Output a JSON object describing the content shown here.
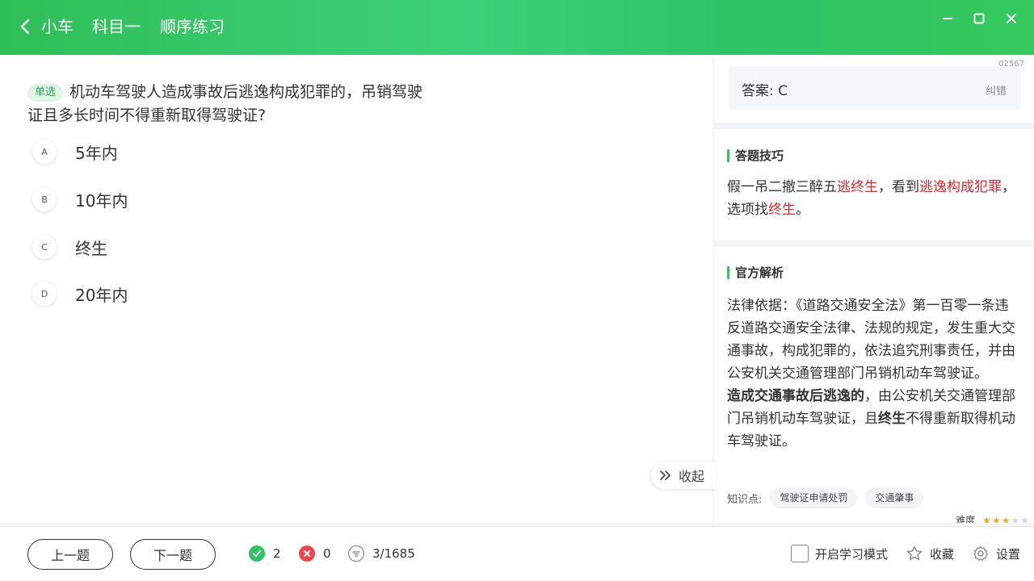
{
  "header": {
    "crumbs": [
      "小车",
      "科目一",
      "顺序练习"
    ],
    "window_controls": [
      "minimize-icon",
      "maximize-icon",
      "close-icon"
    ]
  },
  "question": {
    "badge": "单选",
    "text": "机动车驾驶人造成事故后逃逸构成犯罪的，吊销驾驶证且多长时间不得重新取得驾驶证?",
    "options": [
      {
        "letter": "A",
        "text": "5年内"
      },
      {
        "letter": "B",
        "text": "10年内"
      },
      {
        "letter": "C",
        "text": "终生"
      },
      {
        "letter": "D",
        "text": "20年内"
      }
    ]
  },
  "collapse_label": "收起",
  "side": {
    "qid": "02567",
    "answer": "答案: C",
    "fix_label": "纠错",
    "tips": {
      "title": "答题技巧",
      "t1": "假一吊二撤三醉五",
      "r1": "逃终生",
      "t2": "，看到",
      "r2": "逃逸构成犯罪",
      "t3": "，选项找",
      "r3": "终生",
      "t4": "。"
    },
    "analysis": {
      "title": "官方解析",
      "p1": "法律依据：《道路交通安全法》第一百零一条违反道路交通安全法律、法规的规定，发生重大交通事故，构成犯罪的，依法追究刑事责任，并由公安机关交通管理部门吊销机动车驾驶证。",
      "b1": "造成交通事故后逃逸的",
      "p2": "，由公安机关交通管理部门吊销机动车驾驶证，且",
      "b2": "终生",
      "p3": "不得重新取得机动车驾驶证。"
    },
    "knowledge_label": "知识点:",
    "tags": [
      "驾驶证申请处罚",
      "交通肇事"
    ],
    "difficulty_label": "难度",
    "difficulty_stars": 3,
    "difficulty_max": 5
  },
  "footer": {
    "prev": "上一题",
    "next": "下一题",
    "correct_count": "2",
    "wrong_count": "0",
    "progress": "3/1685",
    "study_mode": "开启学习模式",
    "favorite": "收藏",
    "settings": "设置"
  },
  "colors": {
    "accent": "#2ec466",
    "highlight_red": "#e8262c",
    "wrong_red": "#f0474b",
    "star": "#f5a623"
  }
}
